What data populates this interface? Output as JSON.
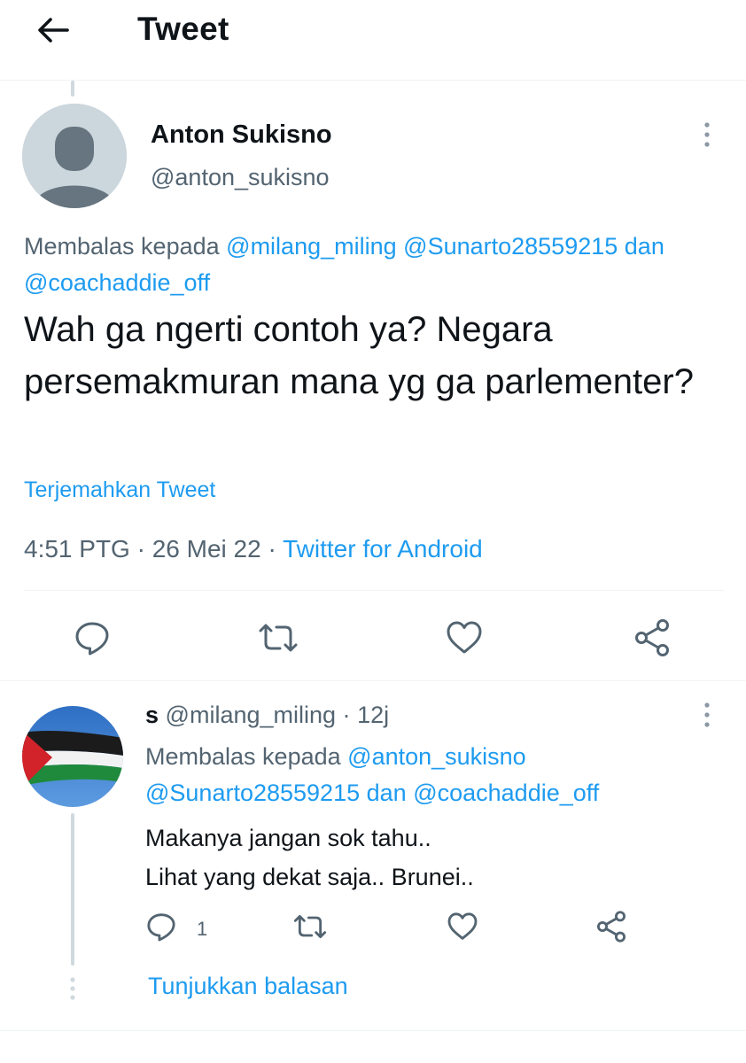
{
  "header": {
    "title": "Tweet",
    "back_icon": "arrow-left-icon"
  },
  "main_tweet": {
    "display_name": "Anton Sukisno",
    "handle": "@anton_sukisno",
    "avatar_icon": "default-avatar-icon",
    "reply_prefix": "Membalas kepada",
    "reply_mentions": [
      "@milang_miling",
      "@Sunarto28559215"
    ],
    "reply_conjunction": "dan",
    "reply_last_mention": "@coachaddie_off",
    "text": "Wah ga ngerti contoh ya? Negara persemakmuran mana yg ga parlementer?",
    "translate_label": "Terjemahkan Tweet",
    "time": "4:51 PTG",
    "separator": "·",
    "date": "26 Mei 22",
    "source": "Twitter for Android",
    "actions": [
      "reply-icon",
      "retweet-icon",
      "like-icon",
      "share-icon"
    ]
  },
  "reply_tweet": {
    "display_name": "s",
    "handle": "@milang_miling",
    "separator": "·",
    "age": "12j",
    "avatar_icon": "palestine-flag-avatar",
    "reply_prefix": "Membalas kepada",
    "reply_mention_1": "@anton_sukisno",
    "reply_mention_2": "@Sunarto28559215",
    "reply_conjunction": "dan",
    "reply_mention_3": "@coachaddie_off",
    "text_line_1": "Makanya jangan sok tahu..",
    "text_line_2": "Lihat yang dekat saja.. Brunei..",
    "reply_count": "1",
    "show_replies_label": "Tunjukkan balasan"
  },
  "colors": {
    "accent": "#1d9bf0",
    "text": "#0f1419",
    "muted": "#536471",
    "divider": "#eff3f4"
  }
}
